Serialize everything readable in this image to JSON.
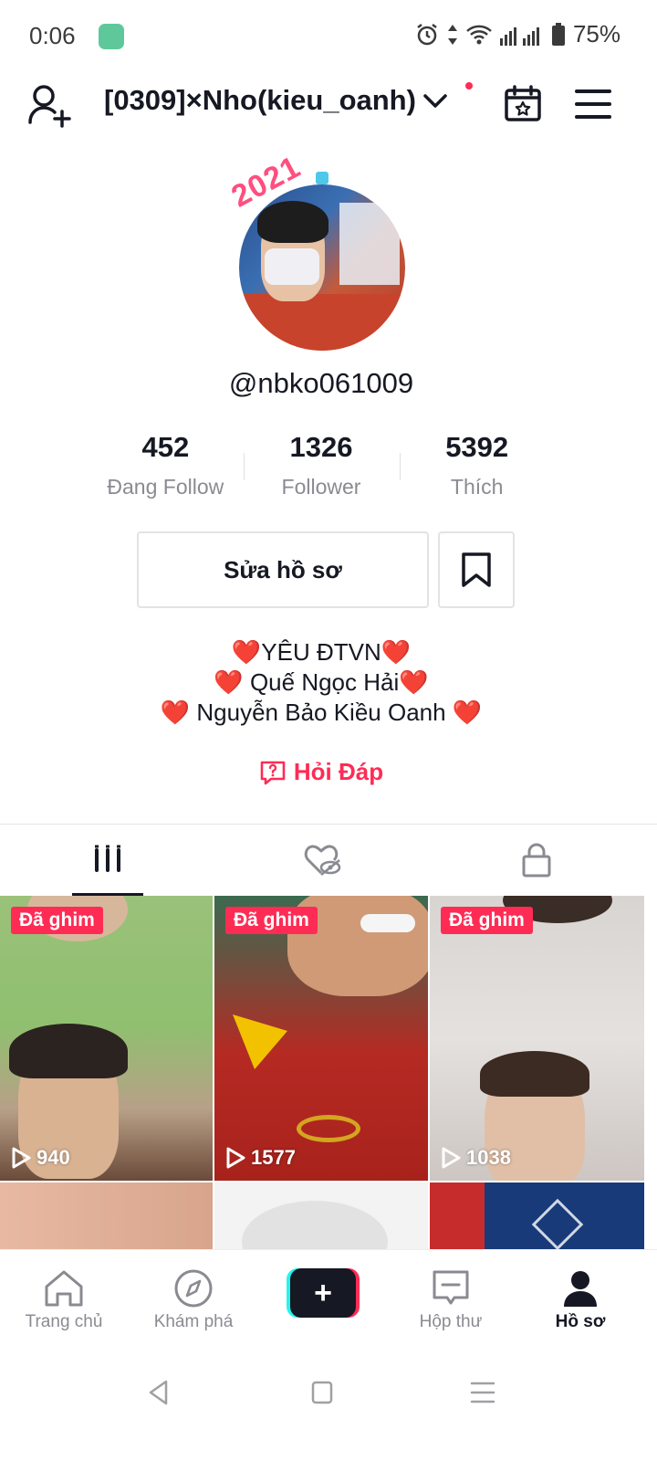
{
  "status_bar": {
    "time": "0:06",
    "battery": "75%"
  },
  "header": {
    "username": "[0309]×Nho(kieu_oanh)"
  },
  "profile": {
    "handle": "@nbko061009"
  },
  "stats": [
    {
      "value": "452",
      "label": "Đang Follow"
    },
    {
      "value": "1326",
      "label": "Follower"
    },
    {
      "value": "5392",
      "label": "Thích"
    }
  ],
  "buttons": {
    "edit_profile": "Sửa hồ sơ"
  },
  "bio": {
    "line1": "❤️YÊU ĐTVN❤️",
    "line2": "❤️ Quế Ngọc Hải❤️",
    "line3": "❤️ Nguyễn Bảo Kiều Oanh ❤️"
  },
  "qa": {
    "label": "Hỏi Đáp"
  },
  "tabs": [
    {
      "icon": "videos-grid-icon"
    },
    {
      "icon": "liked-hidden-icon"
    },
    {
      "icon": "lock-icon"
    }
  ],
  "videos": [
    {
      "pinned_label": "Đã ghim",
      "views": "940"
    },
    {
      "pinned_label": "Đã ghim",
      "views": "1577"
    },
    {
      "pinned_label": "Đã ghim",
      "views": "1038"
    }
  ],
  "bottom_nav": [
    {
      "label": "Trang chủ",
      "icon": "home-icon"
    },
    {
      "label": "Khám phá",
      "icon": "compass-icon"
    },
    {
      "label": "",
      "icon": "plus-icon"
    },
    {
      "label": "Hộp thư",
      "icon": "inbox-icon"
    },
    {
      "label": "Hồ sơ",
      "icon": "profile-icon"
    }
  ],
  "colors": {
    "accent": "#fe2c55",
    "accent2": "#25f4ee",
    "text": "#161823",
    "muted": "#8a8b91"
  }
}
